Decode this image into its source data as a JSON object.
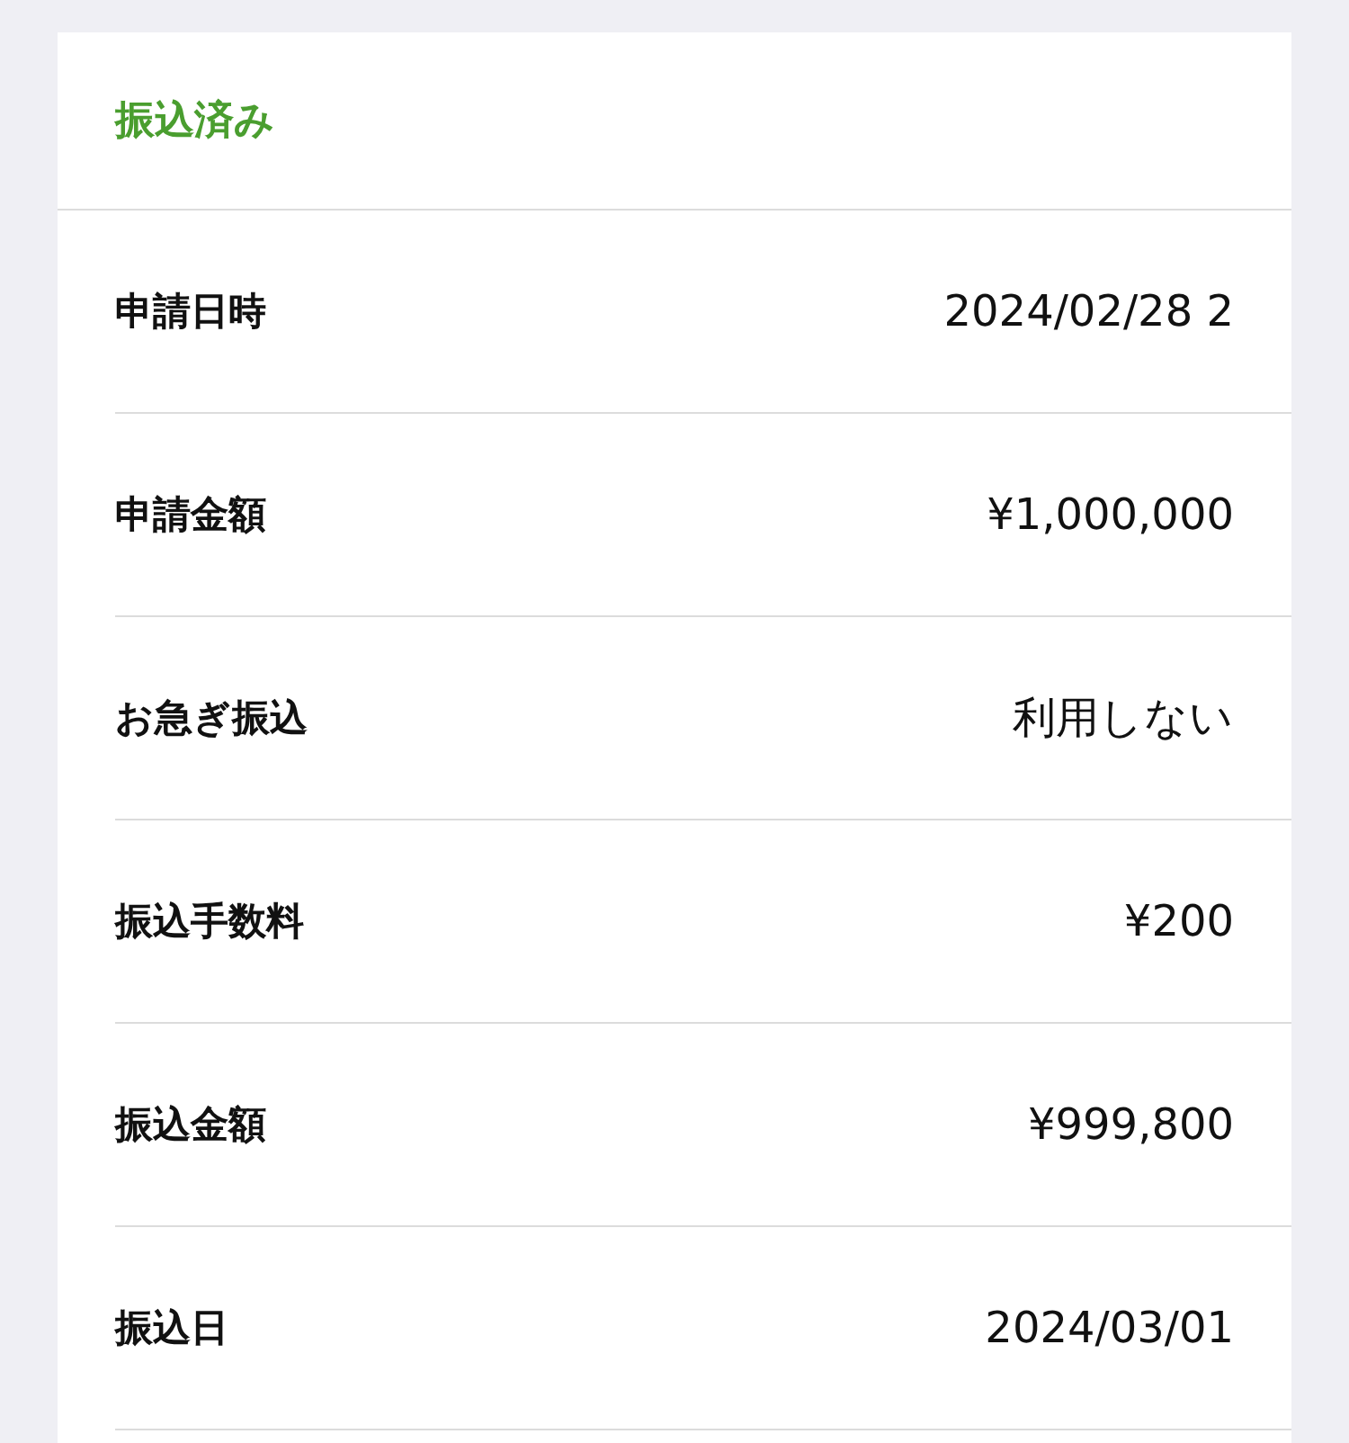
{
  "status": "振込済み",
  "rows": [
    {
      "label": "申請日時",
      "value": "2024/02/28 2"
    },
    {
      "label": "申請金額",
      "value": "¥1,000,000"
    },
    {
      "label": "お急ぎ振込",
      "value": "利用しない"
    },
    {
      "label": "振込手数料",
      "value": "¥200"
    },
    {
      "label": "振込金額",
      "value": "¥999,800"
    },
    {
      "label": "振込日",
      "value": "2024/03/01"
    }
  ]
}
